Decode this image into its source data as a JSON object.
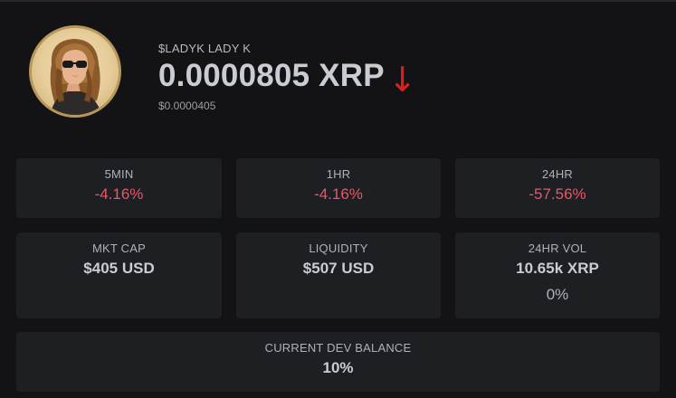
{
  "token": {
    "ticker_name": "$LADYK LADY K",
    "price_xrp": "0.0000805 XRP",
    "trend_arrow": "↓",
    "price_usd": "$0.0000405",
    "avatar_icon": "lady-portrait-avatar-icon"
  },
  "changes": [
    {
      "label": "5MIN",
      "value": "-4.16%"
    },
    {
      "label": "1HR",
      "value": "-4.16%"
    },
    {
      "label": "24HR",
      "value": "-57.56%"
    }
  ],
  "stats": {
    "mkt_cap": {
      "label": "MKT CAP",
      "value": "$405 USD"
    },
    "liquidity": {
      "label": "LIQUIDITY",
      "value": "$507 USD"
    },
    "vol_24hr": {
      "label": "24HR VOL",
      "value": "10.65k XRP",
      "sub": "0%"
    }
  },
  "dev_balance": {
    "label": "CURRENT DEV BALANCE",
    "value": "10%"
  },
  "colors": {
    "negative": "#ef5566",
    "down_arrow": "#e01d1d",
    "card_bg": "#1e1f22",
    "page_bg": "#131316"
  }
}
